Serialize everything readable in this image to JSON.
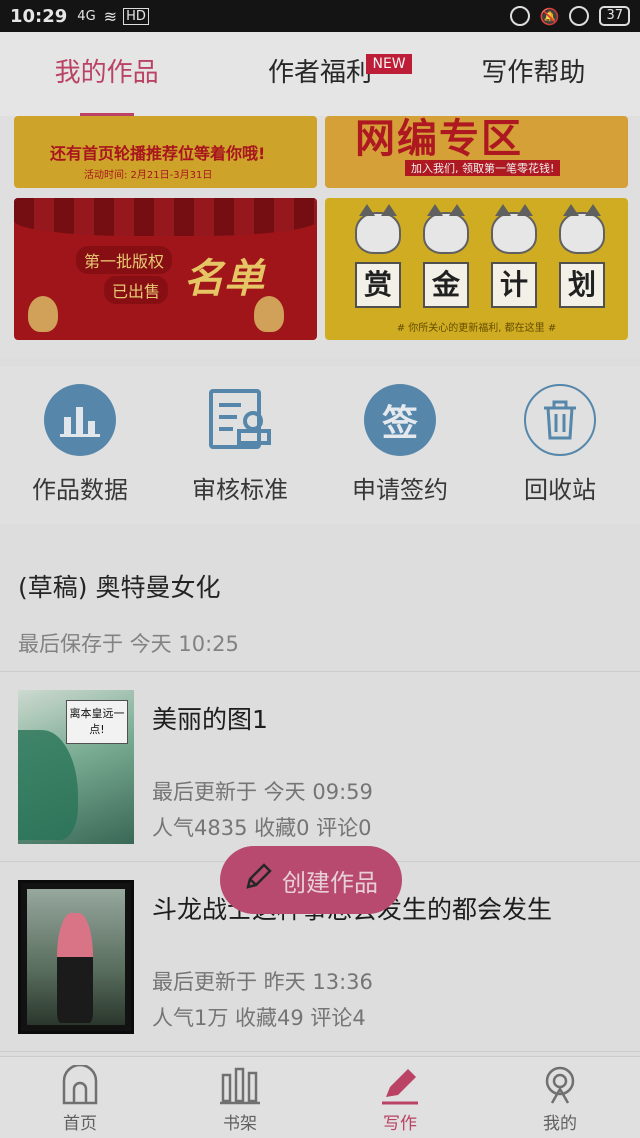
{
  "status_bar": {
    "time": "10:29",
    "signal": "4G",
    "net": "HD",
    "battery": "37"
  },
  "top_tabs": [
    {
      "label": "我的作品",
      "active": true
    },
    {
      "label": "作者福利",
      "badge": "NEW"
    },
    {
      "label": "写作帮助"
    }
  ],
  "banners": {
    "b1": {
      "line1": "还有首页轮播推荐位等着你哦!",
      "line2": "活动时间: 2月21日-3月31日"
    },
    "b2": {
      "title": "网编专区",
      "sub": "加入我们, 领取第一笔零花钱!"
    },
    "b3": {
      "pill1": "第一批版权",
      "pill2": "已出售",
      "script": "名单"
    },
    "b4": {
      "c1": "赏",
      "c2": "金",
      "c3": "计",
      "c4": "划",
      "caption": "# 你所关心的更新福利, 都在这里 #"
    }
  },
  "tools": [
    {
      "label": "作品数据"
    },
    {
      "label": "审核标准"
    },
    {
      "label": "申请签约",
      "glyph": "签"
    },
    {
      "label": "回收站"
    }
  ],
  "draft": {
    "title": "(草稿) 奥特曼女化",
    "saved": "最后保存于 今天 10:25"
  },
  "works": [
    {
      "title": "美丽的图1",
      "updated": "最后更新于 今天 09:59",
      "stats": "人气4835 收藏0 评论0",
      "cover_text": "离本皇远一点!"
    },
    {
      "title": "斗龙战士这种事总会发生的都会发生",
      "updated": "最后更新于 昨天 13:36",
      "stats": "人气1万 收藏49 评论4"
    }
  ],
  "fab": {
    "label": "创建作品"
  },
  "bottom_nav": [
    {
      "label": "首页"
    },
    {
      "label": "书架"
    },
    {
      "label": "写作",
      "active": true
    },
    {
      "label": "我的"
    }
  ],
  "colors": {
    "accent": "#c4476b",
    "tool_blue": "#5b8fb5",
    "fab": "#c24f77"
  }
}
